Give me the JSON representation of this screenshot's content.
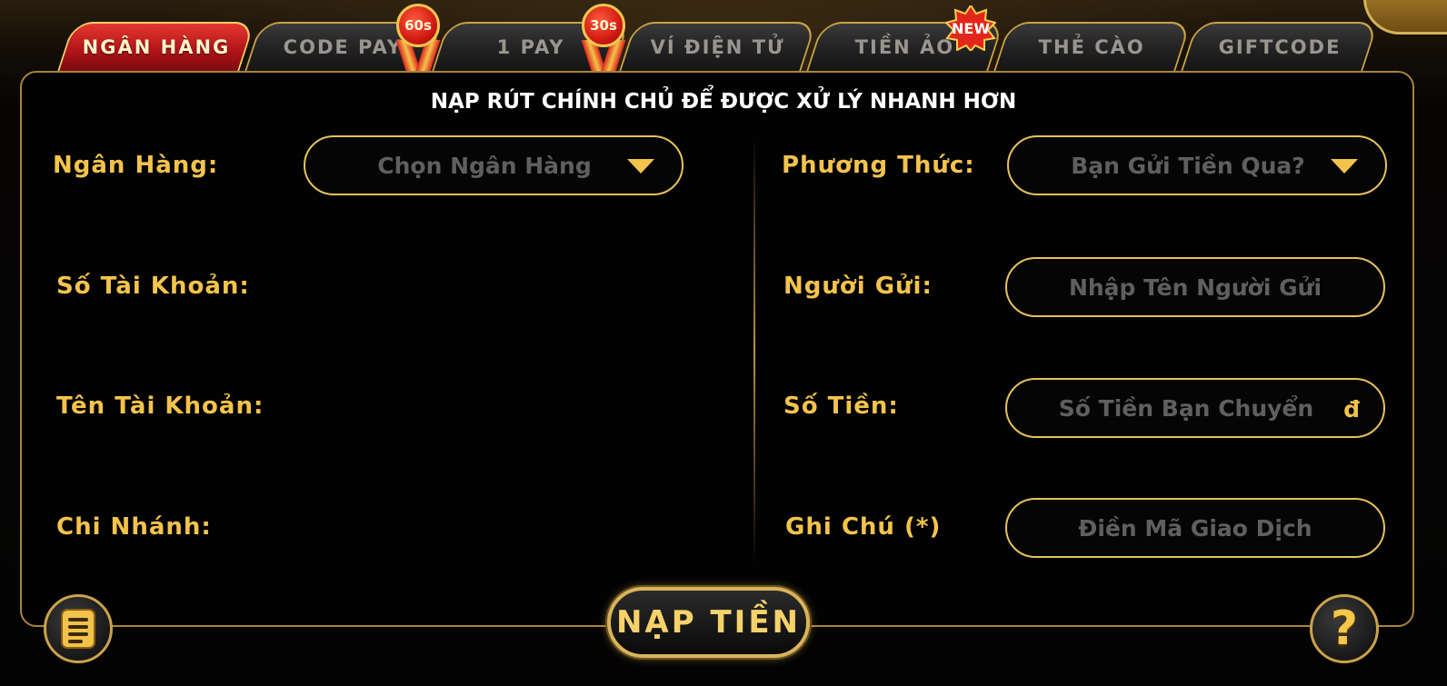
{
  "tabs": [
    {
      "label": "NGÂN HÀNG",
      "active": true
    },
    {
      "label": "CODE PAY",
      "badge": "60s"
    },
    {
      "label": "1 PAY",
      "badge": "30s"
    },
    {
      "label": "VÍ ĐIỆN TỬ"
    },
    {
      "label": "TIỀN ẢO",
      "badge": "NEW"
    },
    {
      "label": "THẺ CÀO"
    },
    {
      "label": "GIFTCODE"
    }
  ],
  "headline": "NẠP RÚT CHÍNH CHỦ ĐỂ ĐƯỢC XỬ LÝ NHANH HƠN",
  "left": {
    "bank_label": "Ngân Hàng:",
    "bank_select": "Chọn Ngân Hàng",
    "account_number_label": "Số Tài Khoản:",
    "account_name_label": "Tên Tài Khoản:",
    "branch_label": "Chi Nhánh:"
  },
  "right": {
    "method_label": "Phương Thức:",
    "method_select": "Bạn Gửi Tiền Qua?",
    "sender_label": "Người Gửi:",
    "sender_placeholder": "Nhập Tên Người Gửi",
    "amount_label": "Số Tiền:",
    "amount_placeholder": "Số Tiền Bạn Chuyển",
    "currency": "đ",
    "note_label": "Ghi Chú (*)",
    "note_placeholder": "Điền Mã Giao Dịch"
  },
  "submit_label": "NẠP TIỀN",
  "help_glyph": "?",
  "icons": [
    "history-icon",
    "help-icon",
    "close-icon",
    "dropdown-caret-icon"
  ],
  "colors": {
    "accent": "#f4c34c",
    "active_tab": "#c41b1f",
    "border": "#e6c25c"
  }
}
